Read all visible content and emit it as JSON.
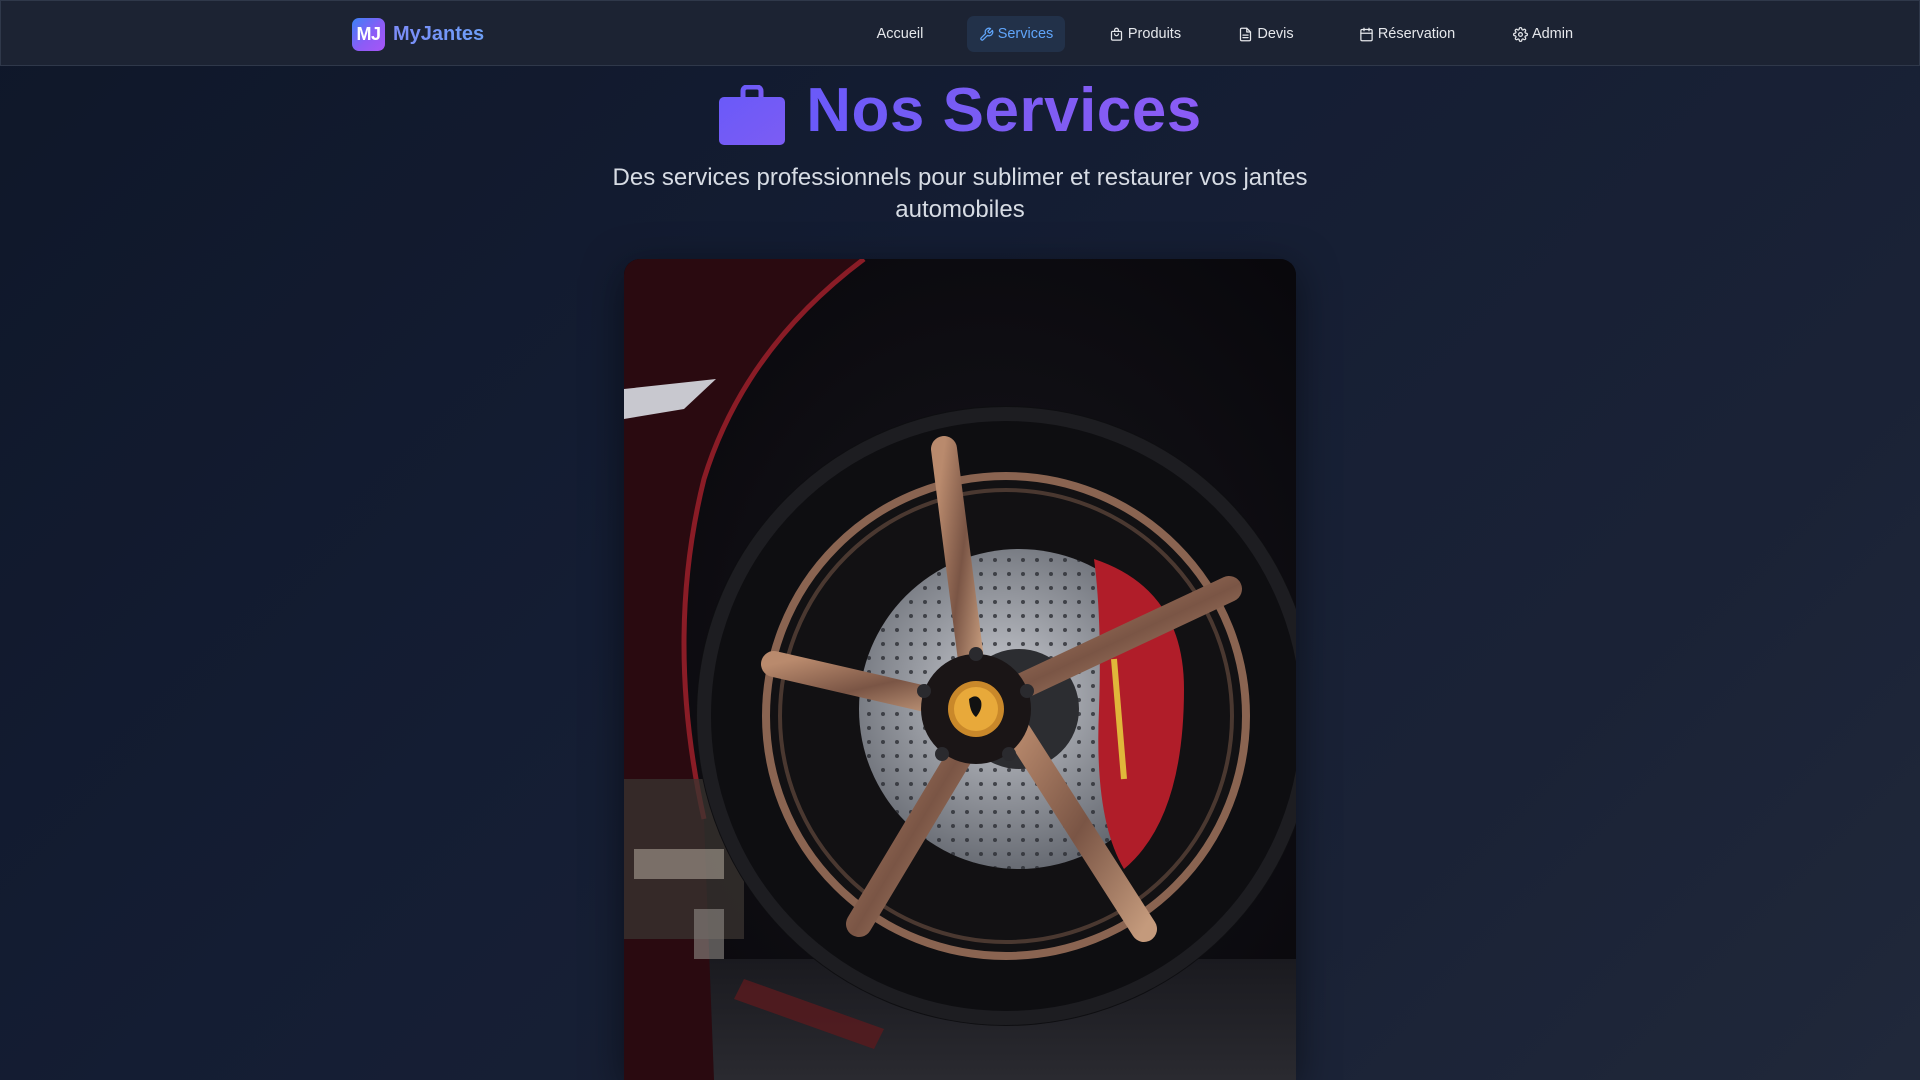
{
  "brand": {
    "badge": "MJ",
    "name": "MyJantes"
  },
  "nav": {
    "items": [
      {
        "label": "Accueil",
        "icon": "",
        "active": false
      },
      {
        "label": "Services",
        "icon": "wrench-icon",
        "active": true
      },
      {
        "label": "Produits",
        "icon": "shopping-bag-icon",
        "active": false
      },
      {
        "label": "Devis",
        "icon": "document-icon",
        "active": false
      },
      {
        "label": "Réservation",
        "icon": "calendar-icon",
        "active": false
      },
      {
        "label": "Admin",
        "icon": "gear-icon",
        "active": false
      }
    ]
  },
  "hero": {
    "icon": "briefcase-icon",
    "title": "Nos Services",
    "subtitle": "Des services professionnels pour sublimer et restaurer vos jantes automobiles",
    "image": "car-wheel-photo"
  },
  "colors": {
    "accent": "#8b5cf6",
    "active_link": "#60a5fa",
    "navbar_bg": "#1c2333",
    "page_bg": "#141d33"
  }
}
